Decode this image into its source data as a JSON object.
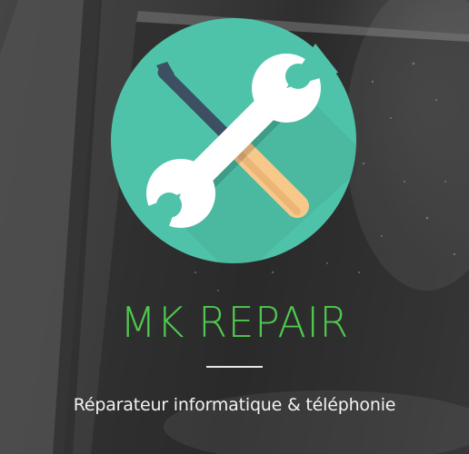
{
  "hero": {
    "brand_name": "MK REPAIR",
    "tagline": "Réparateur informatique & téléphonie"
  },
  "logo": {
    "icon": "tools-icon",
    "circle_color": "#4fc3a9",
    "wrench_color": "#ffffff",
    "screwdriver_handle_color": "#f7c88a",
    "screwdriver_shaft_color": "#3d4f63"
  },
  "colors": {
    "brand_text": "#4ec94e",
    "tagline_text": "#f2f2f2",
    "divider": "#e8e8e8"
  }
}
